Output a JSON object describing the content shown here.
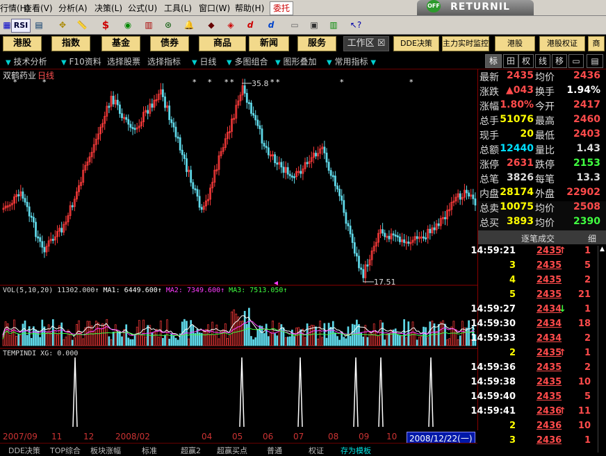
{
  "menu": {
    "items": [
      "行情(H)",
      "查看(V)",
      "分析(A)",
      "决策(L)",
      "公式(U)",
      "工具(L)",
      "窗口(W)",
      "帮助(H)"
    ],
    "special": "委托"
  },
  "returnil": {
    "badge": "OFF",
    "label": "RETURNIL"
  },
  "toolbar": {
    "rsi_label": "RSI"
  },
  "navbar": {
    "buttons": [
      "港股",
      "指数",
      "基金",
      "债券",
      "商品",
      "新闻",
      "服务"
    ],
    "workspace": "工作区",
    "dde": "DDE决策",
    "main_force": "主力实时监控",
    "hk": "港股",
    "hk_warrant": "港股权证"
  },
  "subbar": {
    "items": [
      "技术分析",
      "F10资料",
      "选择股票",
      "选择指标",
      "日线",
      "多图组合",
      "图形叠加",
      "常用指标"
    ],
    "right_tabs": [
      "标",
      "田",
      "权",
      "线",
      "移",
      "▭",
      "▤"
    ]
  },
  "chart": {
    "stock_name": "双鹤药业",
    "period": "日线",
    "high_label": "35.8",
    "low_label": "17.51",
    "vol_line": "VOL(5,10,20) 11302.000↑",
    "ma1_label": "MA1: 6449.600↑",
    "ma2_label": "MA2: 7349.600↑",
    "ma3_label": "MA3: 7513.050↑",
    "temp_label": "TEMPINDI XG: 0.000",
    "colors": {
      "up": "#ff3b3b",
      "down": "#5fd8e8",
      "ma1": "#ffffff",
      "ma2": "#ff3cff",
      "ma3": "#40ff40",
      "frame": "#8b0000"
    }
  },
  "date_axis": {
    "labels": [
      "2007/09",
      "11",
      "12",
      "2008/02",
      "04",
      "05",
      "06",
      "07",
      "08",
      "09",
      "10"
    ],
    "current": "2008/12/22(一)"
  },
  "bottom_tabs": [
    "DDE决策",
    "TOP综合",
    "板块涨幅",
    "标准",
    "超赢2",
    "超赢买点",
    "普通",
    "权证",
    "存为模板"
  ],
  "quote": {
    "rows": [
      {
        "l1": "最新",
        "v1": "2435",
        "l2": "均价",
        "v2": "2436"
      },
      {
        "l1": "涨跌",
        "v1": "▲043",
        "l2": "换手",
        "v2": "1.94%"
      },
      {
        "l1": "涨幅",
        "v1": "1.80%",
        "l2": "今开",
        "v2": "2417"
      },
      {
        "l1": "总手",
        "v1": "51076",
        "l2": "最高",
        "v2": "2460"
      },
      {
        "l1": "现手",
        "v1": "20",
        "l2": "最低",
        "v2": "2403"
      },
      {
        "l1": "总额",
        "v1": "12440",
        "l2": "量比",
        "v2": "1.43"
      },
      {
        "l1": "涨停",
        "v1": "2631",
        "l2": "跌停",
        "v2": "2153"
      },
      {
        "l1": "总笔",
        "v1": "3826",
        "l2": "每笔",
        "v2": "13.3"
      },
      {
        "l1": "内盘",
        "v1": "28174",
        "l2": "外盘",
        "v2": "22902"
      },
      {
        "l1": "总卖",
        "v1": "10075",
        "l2": "均价",
        "v2": "2508"
      },
      {
        "l1": "总买",
        "v1": "3893",
        "l2": "均价",
        "v2": "2390"
      }
    ]
  },
  "ticks": {
    "header": "逐笔成交",
    "detail": "细",
    "rows": [
      {
        "time": "14:59:21",
        "price": "2435",
        "dir": "↑",
        "vol": "1"
      },
      {
        "time": "3",
        "price": "2435",
        "dir": "",
        "vol": "5"
      },
      {
        "time": "4",
        "price": "2435",
        "dir": "",
        "vol": "2"
      },
      {
        "time": "5",
        "price": "2435",
        "dir": "",
        "vol": "21"
      },
      {
        "time": "14:59:27",
        "price": "2434",
        "dir": "↓",
        "vol": "1"
      },
      {
        "time": "14:59:30",
        "price": "2434",
        "dir": "",
        "vol": "18"
      },
      {
        "time": "14:59:33",
        "price": "2434",
        "dir": "",
        "vol": "2"
      },
      {
        "time": "2",
        "price": "2435",
        "dir": "↑",
        "vol": "1"
      },
      {
        "time": "14:59:36",
        "price": "2435",
        "dir": "",
        "vol": "2"
      },
      {
        "time": "14:59:38",
        "price": "2435",
        "dir": "",
        "vol": "10"
      },
      {
        "time": "14:59:40",
        "price": "2435",
        "dir": "",
        "vol": "5"
      },
      {
        "time": "14:59:41",
        "price": "2436",
        "dir": "↑",
        "vol": "11"
      },
      {
        "time": "2",
        "price": "2436",
        "dir": "",
        "vol": "10"
      },
      {
        "time": "3",
        "price": "2436",
        "dir": "",
        "vol": "1"
      }
    ]
  }
}
